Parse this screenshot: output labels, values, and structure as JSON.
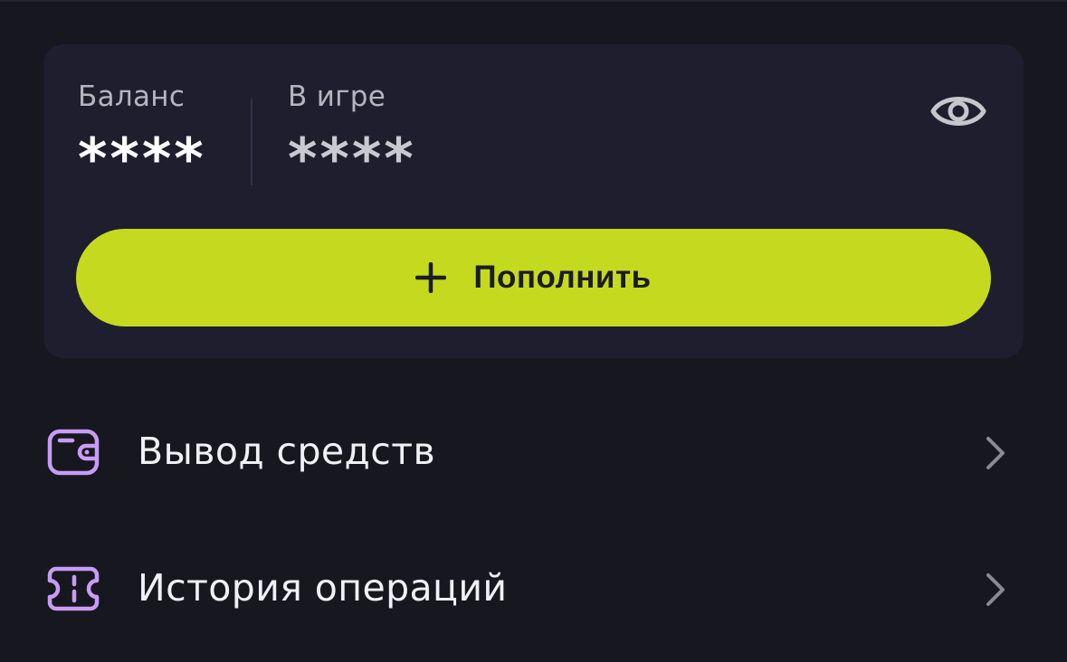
{
  "balance_card": {
    "balance": {
      "label": "Баланс",
      "value": "****"
    },
    "in_game": {
      "label": "В игре",
      "value": "****"
    },
    "toggle_icon": "eye-icon",
    "topup_button": {
      "label": "Пополнить",
      "icon": "plus-icon"
    }
  },
  "menu": {
    "items": [
      {
        "label": "Вывод средств",
        "icon": "wallet-icon"
      },
      {
        "label": "История операций",
        "icon": "ticket-icon"
      }
    ],
    "chevron_icon": "chevron-right-icon"
  },
  "colors": {
    "background": "#17171f",
    "card": "#1e1e2e",
    "accent": "#c5da1e",
    "icon_accent": "#c79cf6",
    "text_primary": "#f0f0f5",
    "text_muted": "#b5b5c0"
  }
}
